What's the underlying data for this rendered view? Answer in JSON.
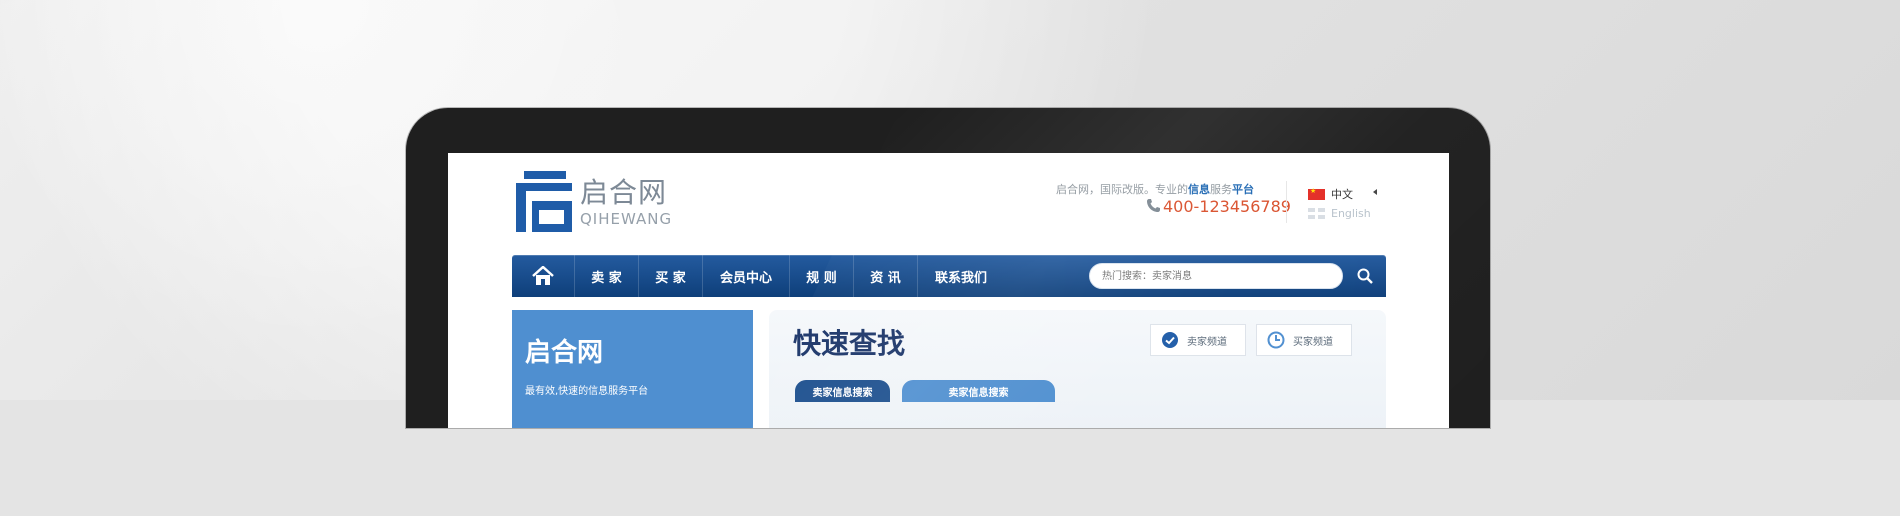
{
  "site": {
    "logo_cn": "启合网",
    "logo_en": "QIHEWANG",
    "tagline_prefix": "启合网，国际改版。专业的",
    "tagline_hl1": "信息",
    "tagline_mid": "服务",
    "tagline_hl2": "平台",
    "phone": "400-123456789"
  },
  "languages": [
    {
      "label": "中文",
      "flag": "cn-flag-icon"
    },
    {
      "label": "English",
      "flag": "uk-flag-icon"
    }
  ],
  "nav": {
    "home_icon": "home-icon",
    "items": [
      "卖 家",
      "买 家",
      "会员中心",
      "规 则",
      "资 讯",
      "联系我们"
    ],
    "search_placeholder": "热门搜索：卖家消息",
    "search_icon": "search-icon"
  },
  "left_panel": {
    "title": "启合网",
    "subtitle": "最有效,快速的信息服务平台"
  },
  "right_panel": {
    "title": "快速查找",
    "channels": [
      {
        "label": "卖家频道",
        "icon": "check-circle-icon"
      },
      {
        "label": "买家频道",
        "icon": "clock-icon"
      }
    ],
    "tabs": [
      "卖家信息搜索",
      "卖家信息搜索"
    ]
  },
  "colors": {
    "nav_blue": "#1a4d8d",
    "brand_blue": "#1f5ca8",
    "light_blue": "#4f8fd0",
    "phone_orange": "#d94e2a"
  }
}
